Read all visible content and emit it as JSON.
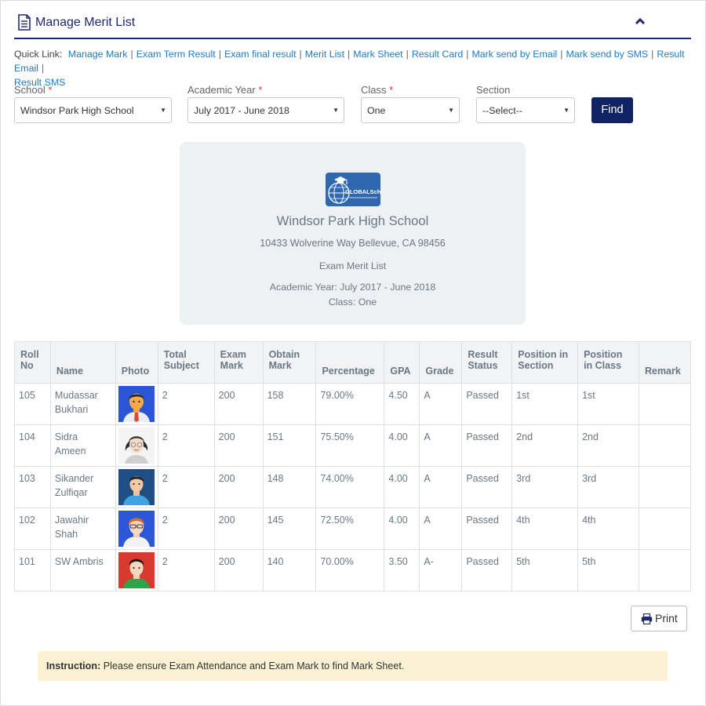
{
  "panel": {
    "title": "Manage Merit List"
  },
  "quick_links": {
    "label": "Quick Link:",
    "items": [
      "Manage Mark",
      "Exam Term Result",
      "Exam final result",
      "Merit List",
      "Mark Sheet",
      "Result Card",
      "Mark send by Email",
      "Mark send by SMS",
      "Result Email",
      "Result SMS"
    ]
  },
  "filters": {
    "school": {
      "label": "School",
      "value": "Windsor Park High School"
    },
    "academic_year": {
      "label": "Academic Year",
      "value": "July 2017 - June 2018"
    },
    "class": {
      "label": "Class",
      "value": "One"
    },
    "section": {
      "label": "Section",
      "value": "--Select--"
    },
    "required_mark": "*",
    "find_label": "Find"
  },
  "report": {
    "logo_text": "GLOBALSchool",
    "school_name": "Windsor Park High School",
    "address": "10433 Wolverine Way Bellevue, CA 98456",
    "title": "Exam Merit List",
    "academic_year": "Academic Year: July 2017 - June 2018",
    "class": "Class: One"
  },
  "table": {
    "headers": {
      "roll": [
        "Roll",
        "No"
      ],
      "name": "Name",
      "photo": "Photo",
      "total_subject": [
        "Total",
        "Subject"
      ],
      "exam_mark": [
        "Exam",
        "Mark"
      ],
      "obtain_mark": [
        "Obtain",
        "Mark"
      ],
      "percentage": "Percentage",
      "gpa": "GPA",
      "grade": "Grade",
      "result_status": [
        "Result",
        "Status"
      ],
      "position_section": [
        "Position in",
        "Section"
      ],
      "position_class": [
        "Position",
        "in Class"
      ],
      "remark": "Remark"
    },
    "rows": [
      {
        "roll": "105",
        "name": [
          "Mudassar",
          "Bukhari"
        ],
        "photo": "avatar-man-orange-tie",
        "total_subject": "2",
        "exam_mark": "200",
        "obtain_mark": "158",
        "percentage": "79.00%",
        "gpa": "4.50",
        "grade": "A",
        "status": "Passed",
        "pos_section": "1st",
        "pos_class": "1st",
        "remark": ""
      },
      {
        "roll": "104",
        "name": [
          "Sidra",
          "Ameen"
        ],
        "photo": "avatar-woman-glasses",
        "total_subject": "2",
        "exam_mark": "200",
        "obtain_mark": "151",
        "percentage": "75.50%",
        "gpa": "4.00",
        "grade": "A",
        "status": "Passed",
        "pos_section": "2nd",
        "pos_class": "2nd",
        "remark": ""
      },
      {
        "roll": "103",
        "name": [
          "Sikander",
          "Zulfiqar"
        ],
        "photo": "avatar-man-blue-shirt",
        "total_subject": "2",
        "exam_mark": "200",
        "obtain_mark": "148",
        "percentage": "74.00%",
        "gpa": "4.00",
        "grade": "A",
        "status": "Passed",
        "pos_section": "3rd",
        "pos_class": "3rd",
        "remark": ""
      },
      {
        "roll": "102",
        "name": [
          "Jawahir",
          "Shah"
        ],
        "photo": "avatar-man-redhair-glasses",
        "total_subject": "2",
        "exam_mark": "200",
        "obtain_mark": "145",
        "percentage": "72.50%",
        "gpa": "4.00",
        "grade": "A",
        "status": "Passed",
        "pos_section": "4th",
        "pos_class": "4th",
        "remark": ""
      },
      {
        "roll": "101",
        "name": [
          "SW Ambris"
        ],
        "photo": "avatar-man-green-shirt",
        "total_subject": "2",
        "exam_mark": "200",
        "obtain_mark": "140",
        "percentage": "70.00%",
        "gpa": "3.50",
        "grade": "A-",
        "status": "Passed",
        "pos_section": "5th",
        "pos_class": "5th",
        "remark": ""
      }
    ]
  },
  "print_label": "Print",
  "instruction": {
    "label": "Instruction:",
    "text": "Please ensure Exam Attendance and Exam Mark to find Mark Sheet."
  },
  "colors": {
    "brand_navy": "#122363",
    "link_blue": "#1f7bc1",
    "required_red": "#e5343d",
    "card_bg": "#eef1f4",
    "instruction_bg": "#fcf1d2"
  }
}
